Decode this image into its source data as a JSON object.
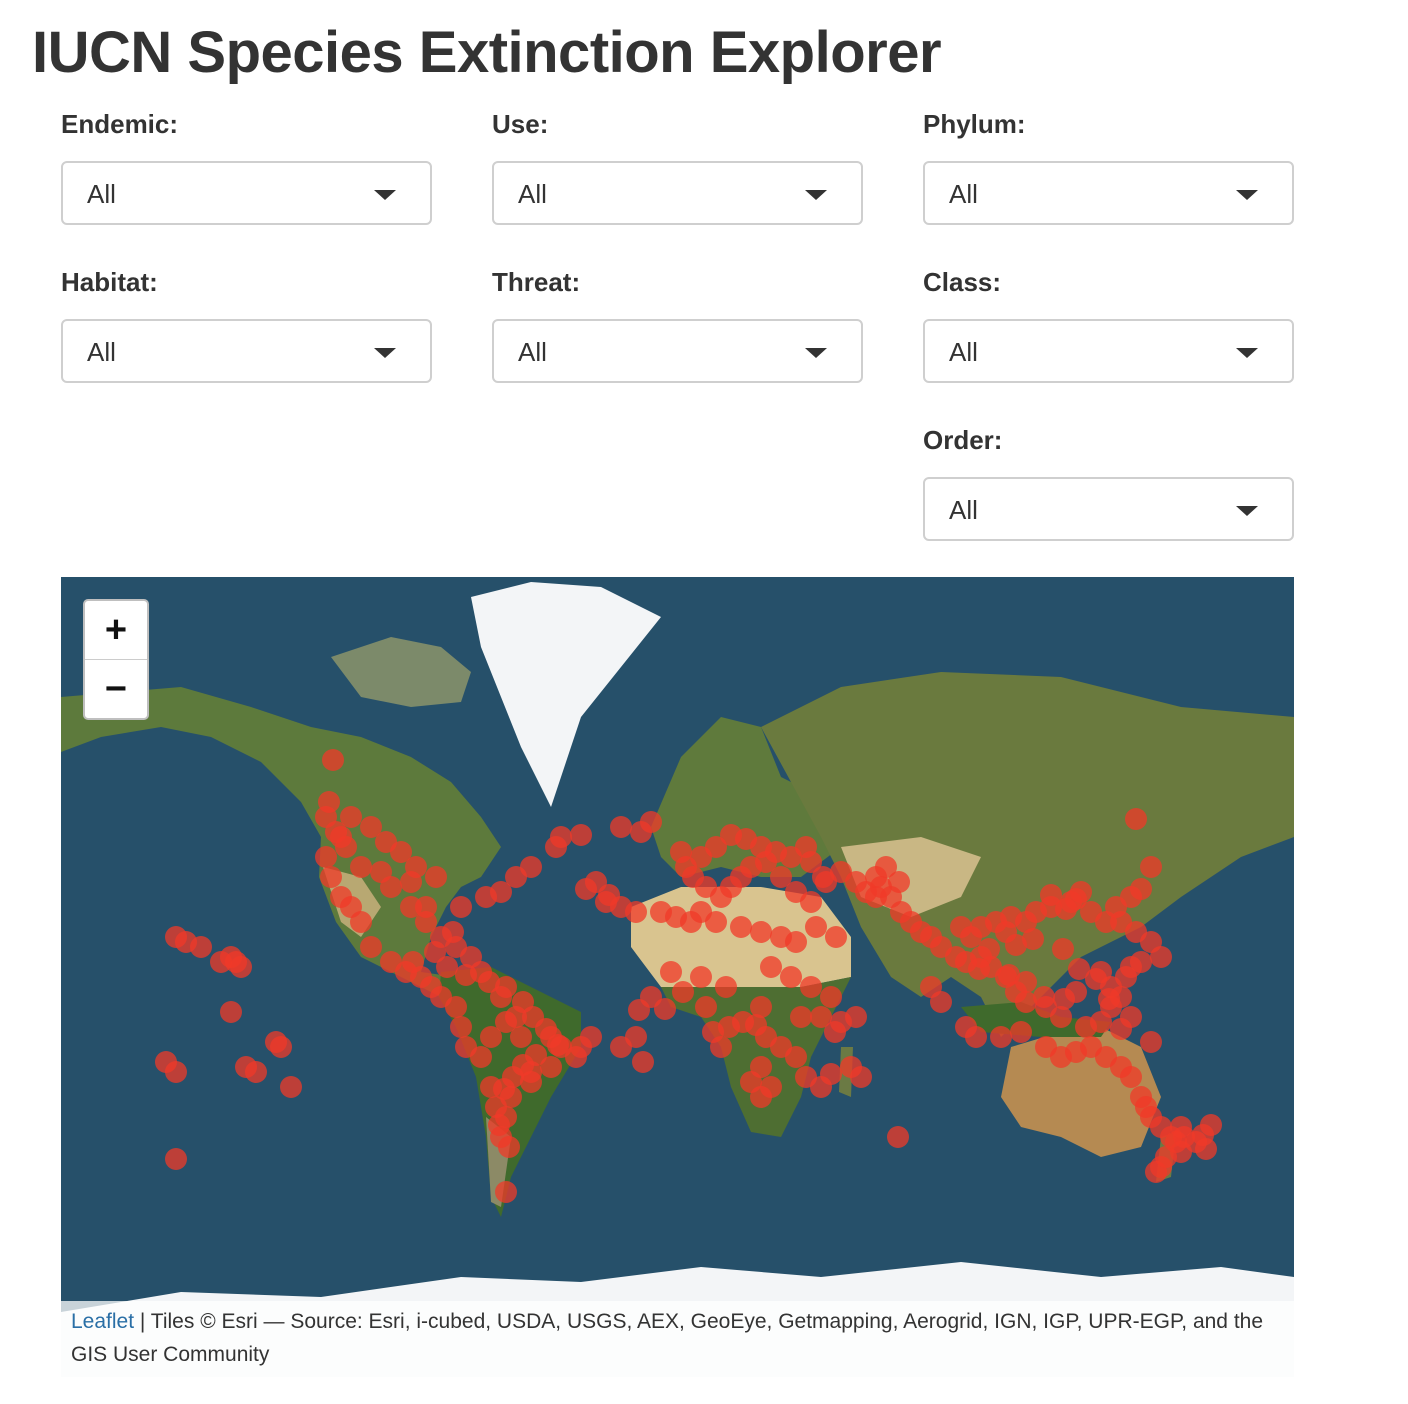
{
  "app": {
    "title": "IUCN Species Extinction Explorer"
  },
  "filters": [
    {
      "id": "endemic",
      "label": "Endemic:",
      "value": "All"
    },
    {
      "id": "use",
      "label": "Use:",
      "value": "All"
    },
    {
      "id": "phylum",
      "label": "Phylum:",
      "value": "All"
    },
    {
      "id": "habitat",
      "label": "Habitat:",
      "value": "All"
    },
    {
      "id": "threat",
      "label": "Threat:",
      "value": "All"
    },
    {
      "id": "class",
      "label": "Class:",
      "value": "All"
    },
    {
      "id": "order",
      "label": "Order:",
      "value": "All"
    }
  ],
  "map": {
    "zoom_in_label": "+",
    "zoom_out_label": "−",
    "marker_color": "#f03a28",
    "attribution": {
      "link_text": "Leaflet",
      "text": " | Tiles © Esri — Source: Esri, i-cubed, USDA, USGS, AEX, GeoEye, Getmapping, Aerogrid, IGN, IGP, UPR-EGP, and the GIS User Community"
    },
    "colors": {
      "ocean": "#26506a",
      "land": "#5d7a3c",
      "desert": "#d9c48f",
      "ice": "#f3f5f7"
    }
  }
}
